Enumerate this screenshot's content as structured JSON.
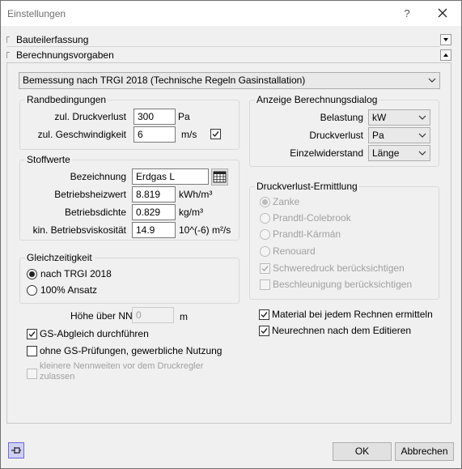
{
  "window": {
    "title": "Einstellungen",
    "help_label": "?"
  },
  "panels": {
    "bauteil": {
      "label": "Bauteilerfassung"
    },
    "berechnung": {
      "label": "Berechnungsvorgaben"
    }
  },
  "norm_select": {
    "value": "Bemessung nach TRGI 2018 (Technische Regeln Gasinstallation)"
  },
  "randbedingungen": {
    "title": "Randbedingungen",
    "druckverlust": {
      "label": "zul. Druckverlust",
      "value": "300",
      "unit": "Pa"
    },
    "geschwindigkeit": {
      "label": "zul. Geschwindigkeit",
      "value": "6",
      "unit": "m/s",
      "checked": true
    }
  },
  "stoffwerte": {
    "title": "Stoffwerte",
    "bezeichnung": {
      "label": "Bezeichnung",
      "value": "Erdgas L"
    },
    "heizwert": {
      "label": "Betriebsheizwert",
      "value": "8.819",
      "unit": "kWh/m³"
    },
    "dichte": {
      "label": "Betriebsdichte",
      "value": "0.829",
      "unit": "kg/m³"
    },
    "viskositaet": {
      "label": "kin. Betriebsviskosität",
      "value": "14.9",
      "unit": "10^(-6) m²/s"
    }
  },
  "gleichzeitigkeit": {
    "title": "Gleichzeitigkeit",
    "options": [
      {
        "label": "nach TRGI 2018",
        "selected": true
      },
      {
        "label": "100% Ansatz",
        "selected": false
      }
    ]
  },
  "anzeige": {
    "title": "Anzeige Berechnungsdialog",
    "belastung": {
      "label": "Belastung",
      "value": "kW"
    },
    "druckverlust": {
      "label": "Druckverlust",
      "value": "Pa"
    },
    "einzelwiderstand": {
      "label": "Einzelwiderstand",
      "value": "Länge"
    }
  },
  "druckverlust_ermittlung": {
    "title": "Druckverlust-Ermittlung",
    "options": [
      {
        "label": "Zanke",
        "selected": true
      },
      {
        "label": "Prandtl-Colebrook",
        "selected": false
      },
      {
        "label": "Prandtl-Kármán",
        "selected": false
      },
      {
        "label": "Renouard",
        "selected": false
      }
    ],
    "schweredruck": {
      "label": "Schweredruck berücksichtigen",
      "checked": true
    },
    "beschleunigung": {
      "label": "Beschleunigung berücksichtigen",
      "checked": false
    }
  },
  "hoehe": {
    "label": "Höhe über NN",
    "value": "0",
    "unit": "m"
  },
  "checks": {
    "gs_abgleich": {
      "label": "GS-Abgleich durchführen",
      "checked": true
    },
    "ohne_gs": {
      "label": "ohne GS-Prüfungen, gewerbliche Nutzung",
      "checked": false
    },
    "kleinere_line1": "kleinere Nennweiten vor dem Druckregler",
    "kleinere_line2": "zulassen",
    "material": {
      "label": "Material bei jedem Rechnen ermitteln",
      "checked": true
    },
    "neurechnen": {
      "label": "Neurechnen nach dem Editieren",
      "checked": true
    }
  },
  "buttons": {
    "ok": "OK",
    "cancel": "Abbrechen"
  }
}
